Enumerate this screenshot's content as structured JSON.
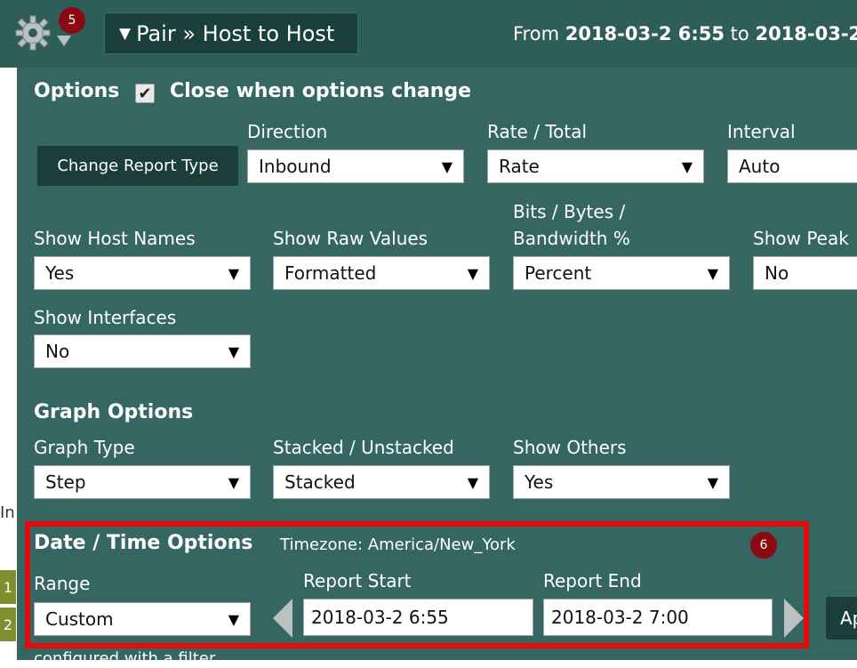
{
  "topbar": {
    "badge": "5",
    "pair_label": "Pair » Host to Host",
    "from_prefix": "From",
    "from_date": "2018-03-2 6:55",
    "to_word": "to",
    "to_date": "2018-03-2"
  },
  "left_strip": {
    "text": "In",
    "items": [
      "1",
      "2"
    ]
  },
  "options": {
    "title": "Options",
    "close_label": "Close when options change",
    "close_checked": true,
    "change_report_label": "Change Report Type",
    "direction": {
      "label": "Direction",
      "value": "Inbound"
    },
    "rate_total": {
      "label": "Rate / Total",
      "value": "Rate"
    },
    "interval": {
      "label": "Interval",
      "value": "Auto"
    },
    "show_host_names": {
      "label": "Show Host Names",
      "value": "Yes"
    },
    "show_raw_values": {
      "label": "Show Raw Values",
      "value": "Formatted"
    },
    "bits_bytes": {
      "label1": "Bits / Bytes /",
      "label2": "Bandwidth %",
      "value": "Percent"
    },
    "show_peak": {
      "label": "Show Peak",
      "value": "No"
    },
    "show_interfaces": {
      "label": "Show Interfaces",
      "value": "No"
    }
  },
  "graph_options": {
    "title": "Graph Options",
    "graph_type": {
      "label": "Graph Type",
      "value": "Step"
    },
    "stacked": {
      "label": "Stacked / Unstacked",
      "value": "Stacked"
    },
    "show_others": {
      "label": "Show Others",
      "value": "Yes"
    }
  },
  "datetime": {
    "title": "Date / Time Options",
    "timezone": "Timezone: America/New_York",
    "badge": "6",
    "range": {
      "label": "Range",
      "value": "Custom"
    },
    "report_start": {
      "label": "Report Start",
      "value": "2018-03-2 6:55"
    },
    "report_end": {
      "label": "Report End",
      "value": "2018-03-2 7:00"
    },
    "apply_label": "Ap"
  },
  "footer_text": "configured with a filter",
  "colors": {
    "panel": "#356661",
    "topbar": "#2f5d57",
    "button_dark": "#1c3e3a",
    "badge_red": "#8b0a12",
    "highlight_red": "#e30b0b"
  },
  "icons": [
    "gear-icon",
    "chevron-down-icon",
    "checkmark-icon",
    "caret-left-icon",
    "caret-right-icon"
  ]
}
